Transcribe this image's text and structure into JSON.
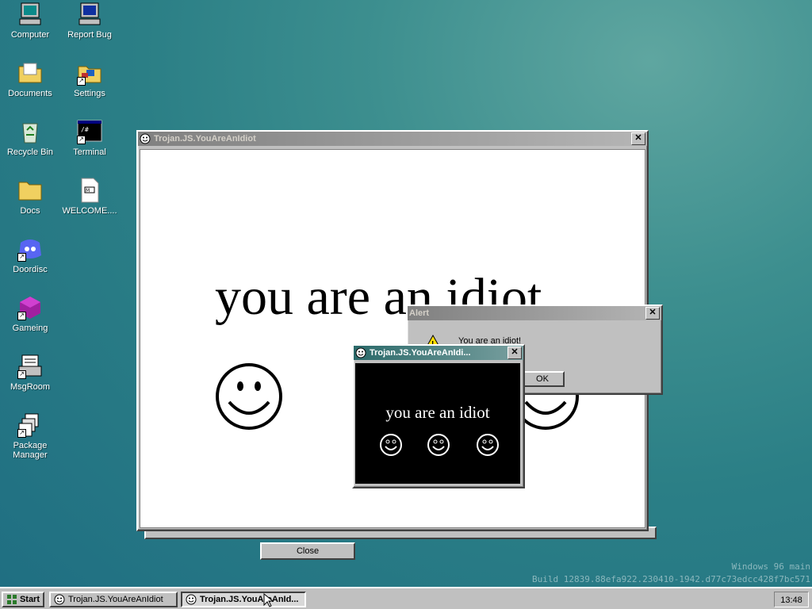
{
  "desktop": {
    "icons": [
      {
        "label": "Computer",
        "icon": "computer-icon"
      },
      {
        "label": "Report Bug",
        "icon": "report-bug-icon"
      },
      {
        "label": "Documents",
        "icon": "documents-folder-icon"
      },
      {
        "label": "Settings",
        "icon": "settings-icon"
      },
      {
        "label": "Recycle Bin",
        "icon": "recycle-bin-icon"
      },
      {
        "label": "Terminal",
        "icon": "terminal-icon"
      },
      {
        "label": "Docs",
        "icon": "docs-folder-icon"
      },
      {
        "label": "WELCOME....",
        "icon": "markdown-file-icon"
      },
      {
        "label": "Doordisc",
        "icon": "doordisc-icon"
      },
      {
        "label": "Gameing",
        "icon": "gameing-icon"
      },
      {
        "label": "MsgRoom",
        "icon": "msgroom-icon"
      },
      {
        "label": "Package Manager",
        "icon": "package-manager-icon"
      }
    ]
  },
  "main_window": {
    "title": "Trojan.JS.YouAreAnIdiot",
    "message": "you are an idiot",
    "close_button": "Close"
  },
  "alert": {
    "title": "Alert",
    "message": "You are an idiot!",
    "ok_button": "OK"
  },
  "popup_window": {
    "title": "Trojan.JS.YouAreAnIdi...",
    "message": "you are an idiot"
  },
  "taskbar": {
    "start_label": "Start",
    "tasks": [
      "Trojan.JS.YouAreAnIdiot",
      "Trojan.JS.YouAreAnId..."
    ],
    "clock": "13:48"
  },
  "watermark": {
    "line1": "Windows 96 main",
    "line2": "Build 12839.88efa922.230410-1942.d77c73edcc428f7bc571"
  },
  "colors": {
    "desktop": "#2b7f86",
    "titlebar_active": "#000080",
    "popup_bg": "#000000"
  }
}
